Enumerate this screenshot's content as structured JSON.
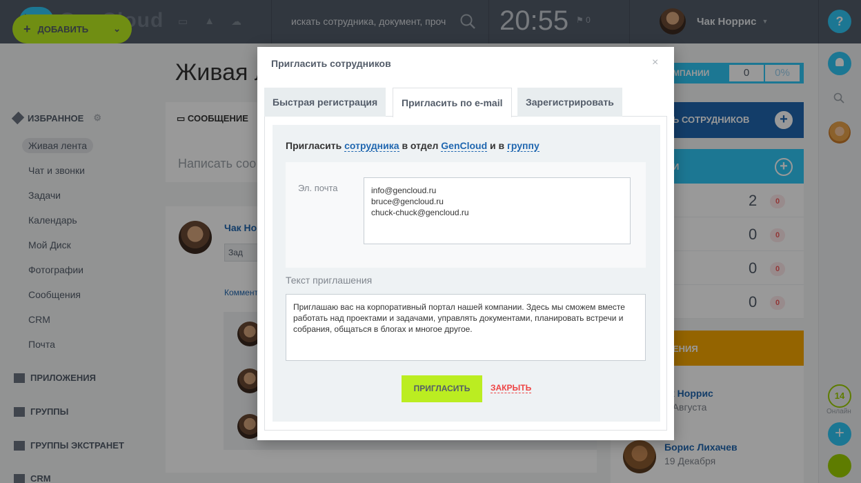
{
  "header": {
    "logo_text": "GenCloud",
    "search_placeholder": "искать сотрудника, документ, проч",
    "time": "20:55",
    "flag_count": "0",
    "user_name": "Чак Норрис",
    "help_label": "?"
  },
  "sidebar": {
    "add_label": "ДОБАВИТЬ",
    "favorites_label": "ИЗБРАННОЕ",
    "items": [
      "Живая лента",
      "Чат и звонки",
      "Задачи",
      "Календарь",
      "Мой Диск",
      "Фотографии",
      "Сообщения",
      "CRM",
      "Почта"
    ],
    "sections": [
      "ПРИЛОЖЕНИЯ",
      "ГРУППЫ",
      "ГРУППЫ ЭКСТРАНЕТ",
      "CRM"
    ]
  },
  "main": {
    "page_title": "Живая л",
    "post_tab": "СООБЩЕНИЕ",
    "write_placeholder": "Написать соо",
    "feed_author": "Чак Но",
    "feed_chip": "Зад",
    "comment_link": "Коммент"
  },
  "right": {
    "company_label": "МПАНИИ",
    "company_count": "0",
    "company_percent": "0%",
    "invite_label": "Ь СОТРУДНИКОВ",
    "extranet_label": "И",
    "counts": [
      "2",
      "0",
      "0",
      "0"
    ],
    "badges": [
      "0",
      "0",
      "0",
      "0"
    ],
    "birthdays_label": "ЕНИЯ",
    "people": [
      {
        "name": "ак Норрис",
        "date": "5 Августа"
      },
      {
        "name": "Борис Лихачев",
        "date": "19 Декабря"
      }
    ]
  },
  "farright": {
    "online_count": "14",
    "online_label": "Онлайн"
  },
  "modal": {
    "title": "Пригласить сотрудников",
    "close_icon": "×",
    "tabs": [
      "Быстрая регистрация",
      "Пригласить по e-mail",
      "Зарегистрировать"
    ],
    "invite_prefix": "Пригласить",
    "invite_link1": "сотрудника",
    "invite_mid": "в отдел",
    "invite_link2": "GenCloud",
    "invite_and": "и в",
    "invite_link3": "группу",
    "email_label": "Эл. почта",
    "emails": "info@gencloud.ru\nbruce@gencloud.ru\nchuck-chuck@gencloud.ru",
    "invite_text_label": "Текст приглашения",
    "invite_text": "Приглашаю вас на корпоративный портал нашей компании. Здесь мы сможем вместе работать над проектами и задачами, управлять документами, планировать встречи и собрания, общаться в блогах и многое другое.",
    "invite_button": "ПРИГЛАСИТЬ",
    "close_button": "ЗАКРЫТЬ"
  }
}
